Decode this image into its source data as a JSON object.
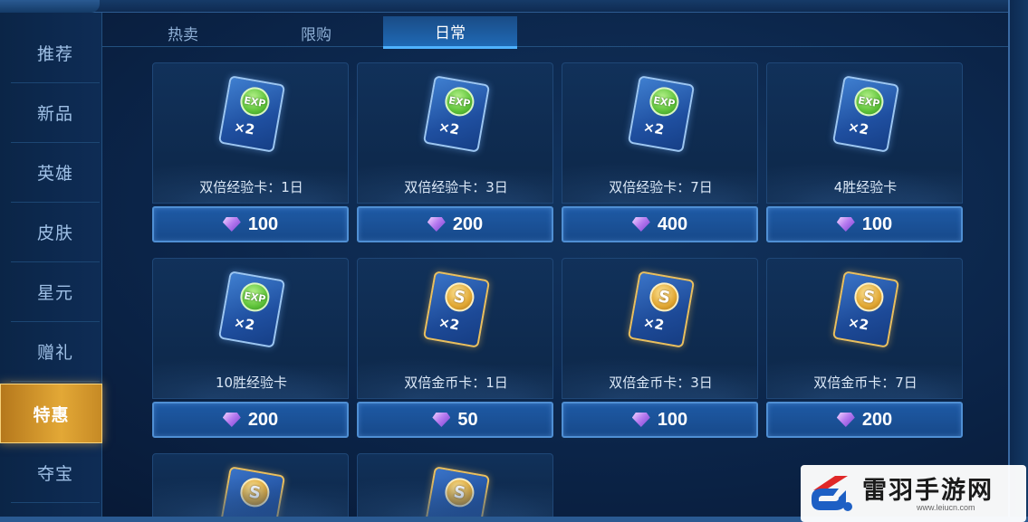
{
  "sidebar": {
    "items": [
      {
        "label": "推荐",
        "active": false
      },
      {
        "label": "新品",
        "active": false
      },
      {
        "label": "英雄",
        "active": false
      },
      {
        "label": "皮肤",
        "active": false
      },
      {
        "label": "星元",
        "active": false
      },
      {
        "label": "赠礼",
        "active": false
      },
      {
        "label": "特惠",
        "active": true
      },
      {
        "label": "夺宝",
        "active": false
      }
    ]
  },
  "tabs": [
    {
      "label": "热卖",
      "active": false
    },
    {
      "label": "限购",
      "active": false
    },
    {
      "label": "日常",
      "active": true
    }
  ],
  "currency_icon": "purple-diamond-gem",
  "items": [
    {
      "name": "双倍经验卡：1日",
      "price": "100",
      "icon": "exp-card"
    },
    {
      "name": "双倍经验卡：3日",
      "price": "200",
      "icon": "exp-card"
    },
    {
      "name": "双倍经验卡：7日",
      "price": "400",
      "icon": "exp-card"
    },
    {
      "name": "4胜经验卡",
      "price": "100",
      "icon": "exp-card"
    },
    {
      "name": "10胜经验卡",
      "price": "200",
      "icon": "exp-card"
    },
    {
      "name": "双倍金币卡：1日",
      "price": "50",
      "icon": "gold-card"
    },
    {
      "name": "双倍金币卡：3日",
      "price": "100",
      "icon": "gold-card"
    },
    {
      "name": "双倍金币卡：7日",
      "price": "200",
      "icon": "gold-card"
    },
    {
      "name": "",
      "price": "",
      "icon": "gold-card"
    },
    {
      "name": "",
      "price": "",
      "icon": "gold-card"
    }
  ],
  "card_icon_text": {
    "exp": "EXP",
    "coin": "S",
    "multiplier": "×2"
  },
  "watermark": {
    "title": "雷羽手游网",
    "url": "www.leiucn.com"
  },
  "colors": {
    "background": "#0b2448",
    "active_side": "#e3a836",
    "price_button": "#1e5aa5",
    "gem": "#b77cf0"
  }
}
